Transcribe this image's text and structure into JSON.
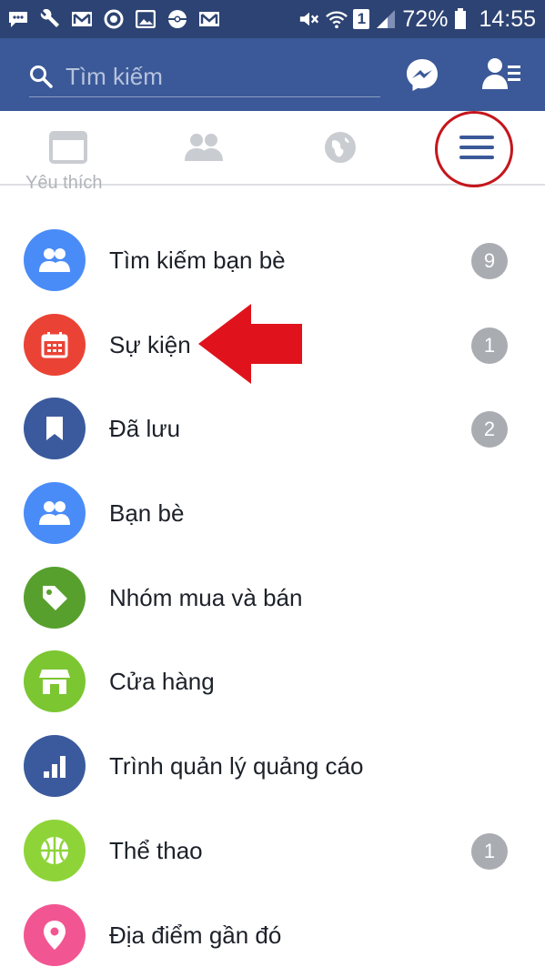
{
  "status_bar": {
    "battery_percent": "72%",
    "time": "14:55",
    "sim_badge": "1",
    "icons": [
      "chat-bubble-icon",
      "wrench-icon",
      "gmail-icon",
      "target-icon",
      "image-icon",
      "game-controller-icon",
      "gmail-icon",
      "mute-icon",
      "wifi-icon",
      "sim-icon",
      "signal-icon",
      "battery-icon"
    ]
  },
  "header": {
    "search_placeholder": "Tìm kiếm",
    "icons": [
      "search-icon",
      "messenger-icon",
      "friend-requests-icon"
    ]
  },
  "tabs": [
    {
      "name": "news-feed",
      "icon": "news-feed-icon"
    },
    {
      "name": "friends",
      "icon": "friends-icon"
    },
    {
      "name": "notifications",
      "icon": "globe-icon"
    },
    {
      "name": "menu",
      "icon": "hamburger-menu-icon",
      "active": true
    }
  ],
  "section_label": "Yêu thích",
  "menu_items": [
    {
      "label": "Tìm kiếm bạn bè",
      "badge": "9",
      "icon": "friends-icon",
      "color": "#4a8cf7"
    },
    {
      "label": "Sự kiện",
      "badge": "1",
      "icon": "calendar-icon",
      "color": "#ea4335"
    },
    {
      "label": "Đã lưu",
      "badge": "2",
      "icon": "bookmark-icon",
      "color": "#3b5a9d"
    },
    {
      "label": "Bạn bè",
      "badge": "",
      "icon": "friends-icon",
      "color": "#4a8cf7"
    },
    {
      "label": "Nhóm mua và bán",
      "badge": "",
      "icon": "price-tag-icon",
      "color": "#58a02d"
    },
    {
      "label": "Cửa hàng",
      "badge": "",
      "icon": "store-icon",
      "color": "#7bc631"
    },
    {
      "label": "Trình quản lý quảng cáo",
      "badge": "",
      "icon": "bar-chart-icon",
      "color": "#3b5a9d"
    },
    {
      "label": "Thể thao",
      "badge": "1",
      "icon": "ball-icon",
      "color": "#8ed439"
    },
    {
      "label": "Địa điểm gần đó",
      "badge": "",
      "icon": "location-pin-icon",
      "color": "#f25692"
    }
  ],
  "colors": {
    "status_bar": "#2d4373",
    "app_bar": "#3b5998",
    "badge": "#a9acb1",
    "annotation_red": "#e0131d"
  }
}
